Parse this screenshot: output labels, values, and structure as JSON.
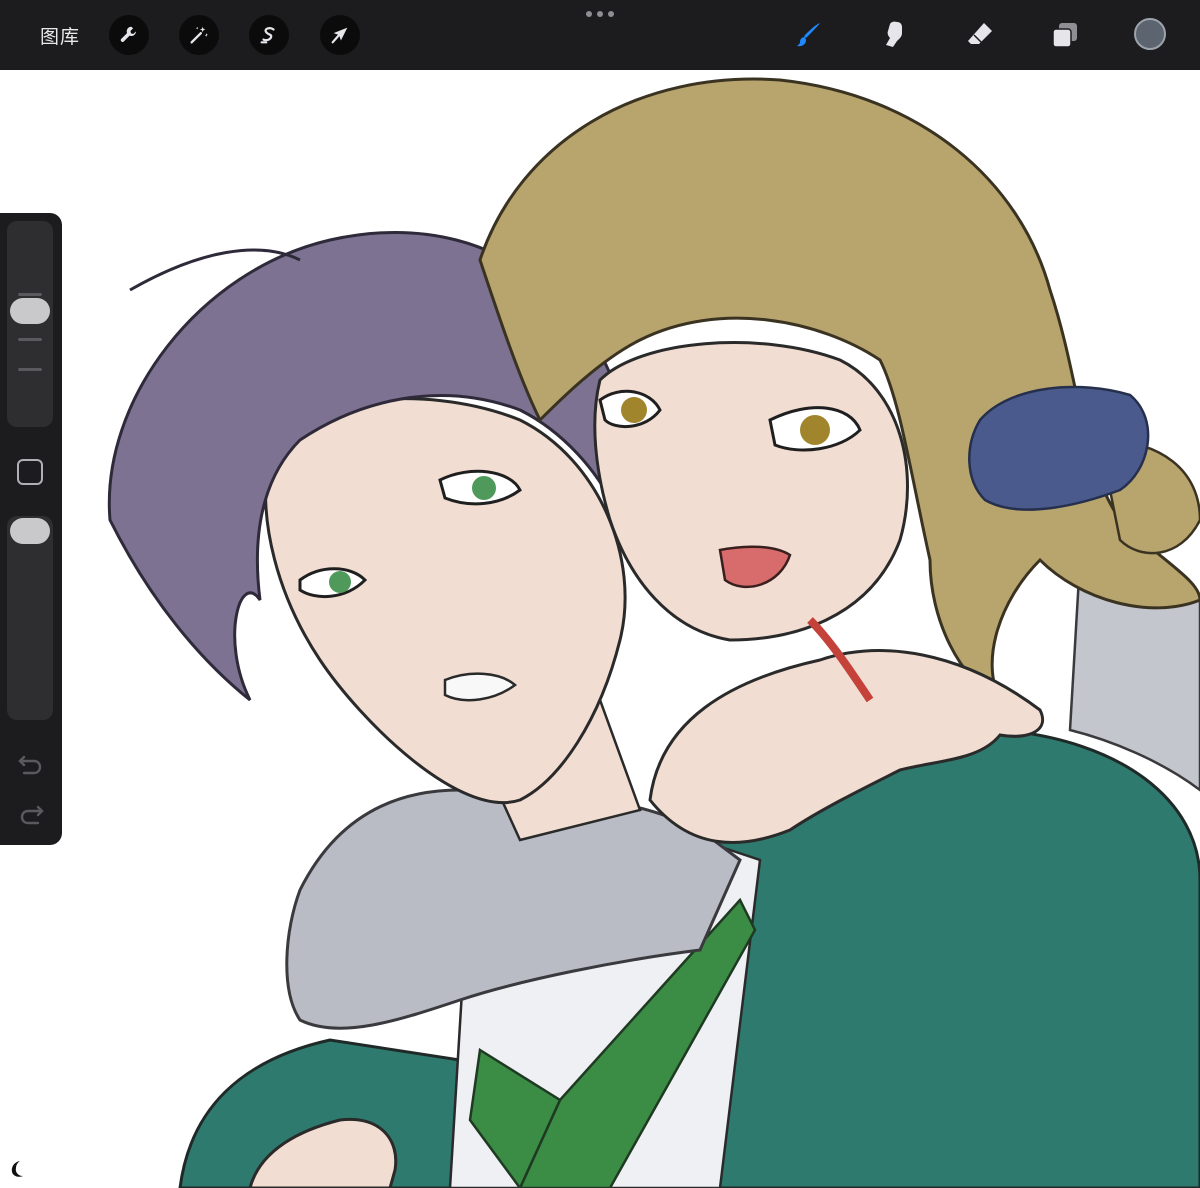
{
  "toolbar": {
    "gallery_label": "图库",
    "left_tools": [
      {
        "name": "actions",
        "icon": "wrench-icon"
      },
      {
        "name": "adjustments",
        "icon": "magic-wand-icon"
      },
      {
        "name": "selection",
        "icon": "selection-s-icon"
      },
      {
        "name": "transform",
        "icon": "arrow-cursor-icon"
      }
    ],
    "right_tools": [
      {
        "name": "brush",
        "icon": "brush-icon",
        "active": true
      },
      {
        "name": "smudge",
        "icon": "smudge-finger-icon"
      },
      {
        "name": "eraser",
        "icon": "eraser-icon"
      },
      {
        "name": "layers",
        "icon": "layers-icon"
      }
    ],
    "current_color": "#5c6470",
    "accent_color": "#1e88ff"
  },
  "sidebar": {
    "brush_size_level": 0.45,
    "opacity_level": 0.95,
    "icons": [
      "modify-square-icon",
      "undo-icon",
      "redo-icon"
    ]
  },
  "palette": {
    "purple_hair": "#7d7291",
    "blonde_hair": "#b8a56d",
    "skin": "#f2ddd2",
    "green_jacket": "#2f7a6e",
    "grey_sleeve": "#b9bcc4",
    "scrunchie": "#4a5a8c",
    "green_tie": "#3b8c45"
  }
}
